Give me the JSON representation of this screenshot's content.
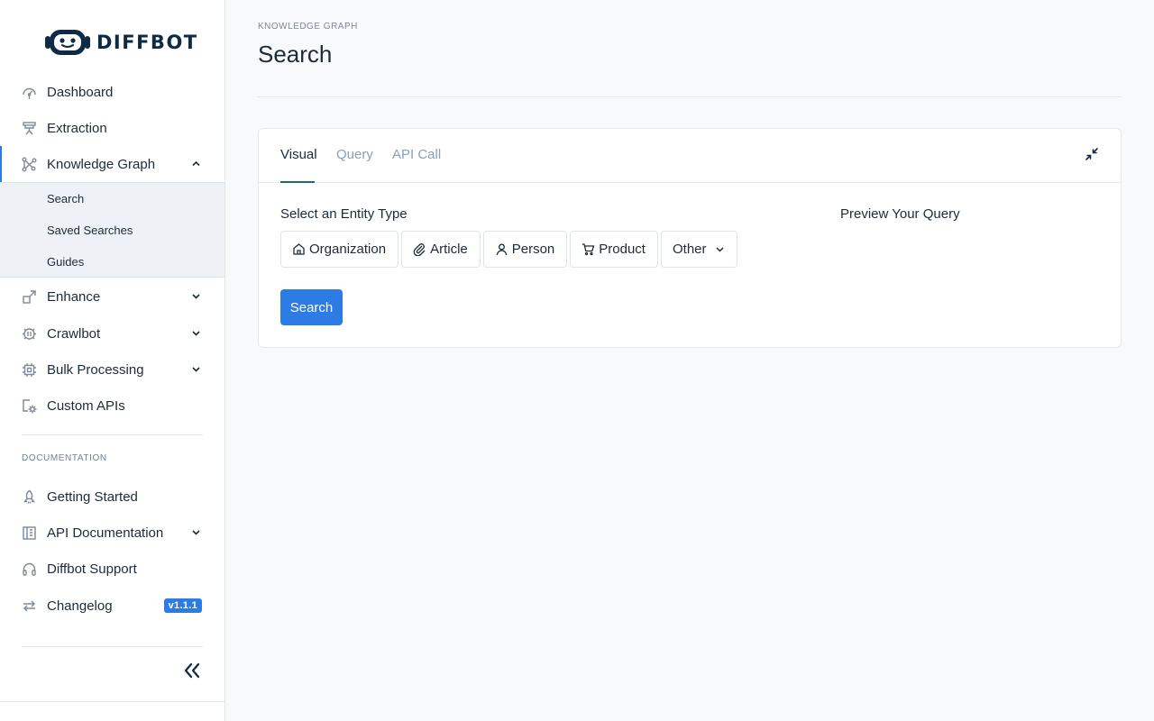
{
  "brand": {
    "name": "DIFFBOT",
    "accent": "#2d7be5"
  },
  "sidebar": {
    "items": [
      {
        "label": "Dashboard",
        "icon": "gauge-icon"
      },
      {
        "label": "Extraction",
        "icon": "extraction-icon"
      },
      {
        "label": "Knowledge Graph",
        "icon": "graph-icon",
        "expanded": true,
        "active": true
      },
      {
        "label": "Enhance",
        "icon": "enhance-icon",
        "expandable": true
      },
      {
        "label": "Crawlbot",
        "icon": "crawlbot-icon",
        "expandable": true
      },
      {
        "label": "Bulk Processing",
        "icon": "chip-icon",
        "expandable": true
      },
      {
        "label": "Custom APIs",
        "icon": "custom-api-icon"
      }
    ],
    "kg_subitems": [
      "Search",
      "Saved Searches",
      "Guides"
    ],
    "docs_section_label": "DOCUMENTATION",
    "doc_items": [
      {
        "label": "Getting Started",
        "icon": "rocket-icon"
      },
      {
        "label": "API Documentation",
        "icon": "book-icon",
        "expandable": true
      },
      {
        "label": "Diffbot Support",
        "icon": "headphones-icon"
      },
      {
        "label": "Changelog",
        "icon": "swap-icon",
        "badge": "v1.1.1"
      }
    ]
  },
  "main": {
    "breadcrumb": "KNOWLEDGE GRAPH",
    "title": "Search",
    "tabs": [
      {
        "label": "Visual",
        "active": true
      },
      {
        "label": "Query"
      },
      {
        "label": "API Call"
      }
    ],
    "select_label": "Select an Entity Type",
    "preview_label": "Preview Your Query",
    "entity_types": [
      {
        "label": "Organization",
        "icon": "building-icon"
      },
      {
        "label": "Article",
        "icon": "paperclip-icon"
      },
      {
        "label": "Person",
        "icon": "person-icon"
      },
      {
        "label": "Product",
        "icon": "cart-icon"
      },
      {
        "label": "Other",
        "icon": "chevron-down-icon"
      }
    ],
    "search_button": "Search"
  }
}
